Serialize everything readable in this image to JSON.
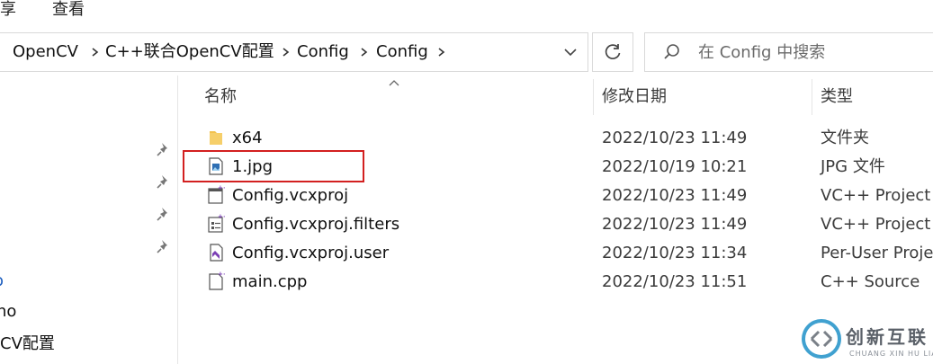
{
  "ribbon": {
    "share_label": "享",
    "view_label": "查看"
  },
  "address": {
    "crumbs": [
      "OpenCV",
      "C++联合OpenCV配置",
      "Config",
      "Config"
    ]
  },
  "search": {
    "placeholder": "在 Config 中搜索"
  },
  "nav": {
    "items": [
      "o",
      "no",
      "CV配置"
    ]
  },
  "columns": {
    "name": "名称",
    "date": "修改日期",
    "type": "类型"
  },
  "files": [
    {
      "name": "x64",
      "date": "2022/10/23 11:49",
      "type": "文件夹",
      "icon": "folder-icon"
    },
    {
      "name": "1.jpg",
      "date": "2022/10/19 10:21",
      "type": "JPG 文件",
      "icon": "image-file-icon"
    },
    {
      "name": "Config.vcxproj",
      "date": "2022/10/23 11:49",
      "type": "VC++ Project",
      "icon": "vcxproj-file-icon"
    },
    {
      "name": "Config.vcxproj.filters",
      "date": "2022/10/23 11:49",
      "type": "VC++ Project F",
      "icon": "filters-file-icon"
    },
    {
      "name": "Config.vcxproj.user",
      "date": "2022/10/23 11:34",
      "type": "Per-User Proje",
      "icon": "vs-user-file-icon"
    },
    {
      "name": "main.cpp",
      "date": "2022/10/23 11:51",
      "type": "C++ Source",
      "icon": "cpp-file-icon"
    }
  ],
  "watermark": {
    "cn": "创新互联",
    "en": "CHUANG XIN HU LIAN"
  },
  "colors": {
    "highlight": "#d32020",
    "folder": "#f2c14e",
    "vs_purple": "#7b3fb5"
  }
}
